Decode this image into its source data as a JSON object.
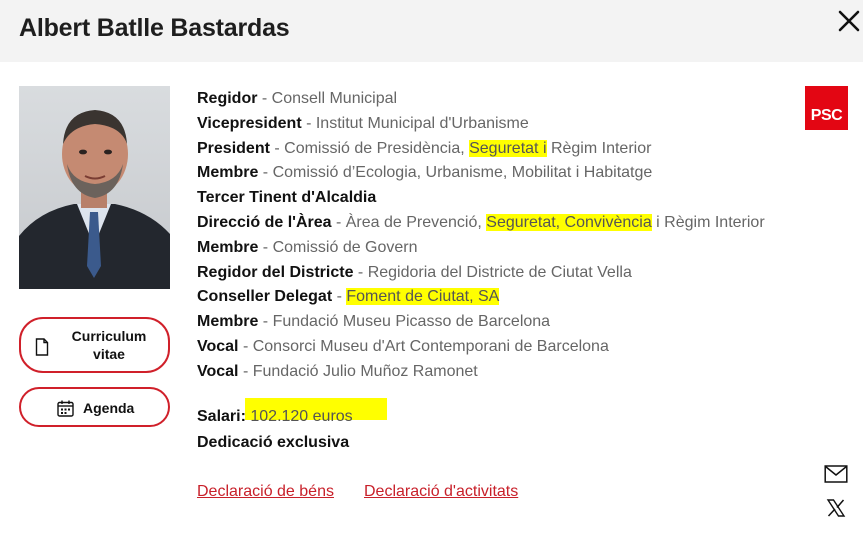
{
  "header": {
    "title": "Albert Batlle Bastardas"
  },
  "icons": {
    "close": "close-icon",
    "cv": "document-icon",
    "agenda": "calendar-icon",
    "mail": "mail-icon",
    "x": "x-twitter-icon"
  },
  "party": {
    "label": "PSC",
    "color": "#e30613"
  },
  "buttons": {
    "cv_label": "Curriculum vitae",
    "agenda_label": "Agenda"
  },
  "roles": [
    {
      "title": "Regidor",
      "sep": " - ",
      "org": "Consell Municipal"
    },
    {
      "title": "Vicepresident",
      "sep": " - ",
      "org": "Institut Municipal d'Urbanisme"
    },
    {
      "title": "President",
      "sep": " - ",
      "org_pre": "Comissió de Presidència, ",
      "org_hl": "Seguretat i",
      "org_post": " Règim Interior"
    },
    {
      "title": "Membre",
      "sep": " - ",
      "org": "Comissió d’Ecologia, Urbanisme, Mobilitat i Habitatge"
    },
    {
      "title": "Tercer Tinent d'Alcaldia",
      "sep": "",
      "org": ""
    },
    {
      "title": "Direcció de l'Àrea",
      "sep": " - ",
      "org_pre": "Àrea de Prevenció, ",
      "org_hl": "Seguretat, Convivència",
      "org_post": " i Règim Interior"
    },
    {
      "title": "Membre",
      "sep": " - ",
      "org": "Comissió de Govern"
    },
    {
      "title": "Regidor del Districte",
      "sep": " - ",
      "org": "Regidoria del Districte de Ciutat Vella"
    },
    {
      "title": "Conseller Delegat",
      "sep": " - ",
      "org_pre": "",
      "org_hl": "Foment de Ciutat, SA",
      "org_post": ""
    },
    {
      "title": "Membre",
      "sep": " - ",
      "org": "Fundació Museu Picasso de Barcelona"
    },
    {
      "title": "Vocal",
      "sep": " - ",
      "org": "Consorci Museu d'Art Contemporani de Barcelona"
    },
    {
      "title": "Vocal",
      "sep": " - ",
      "org": "Fundació Julio Muñoz Ramonet"
    }
  ],
  "salary": {
    "label": "Salari:",
    "value": " 102.120 euros"
  },
  "dedication": "Dedicació exclusiva",
  "links": {
    "benes": "Declaració de béns",
    "activitats": "Declaració d'activitats"
  }
}
